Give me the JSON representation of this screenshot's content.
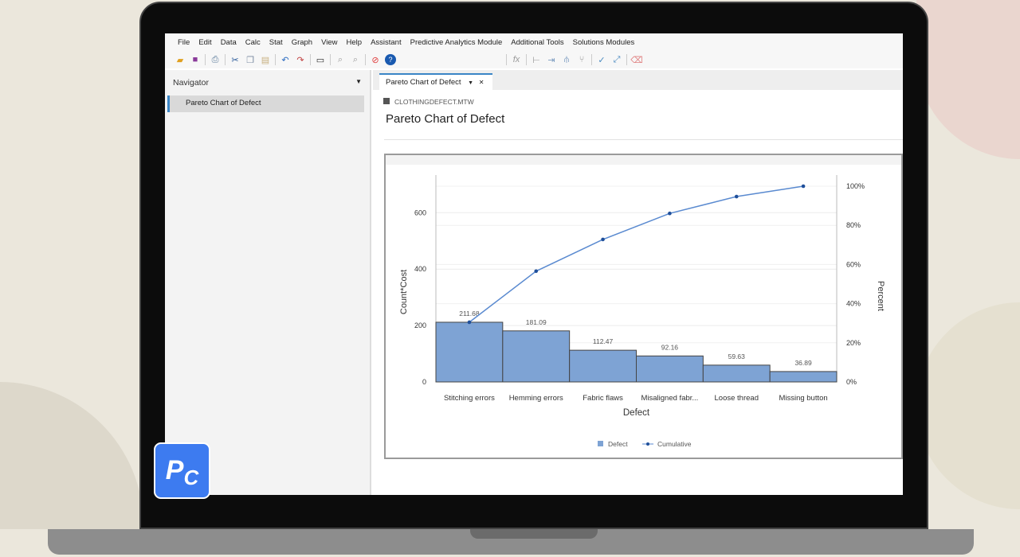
{
  "menu": [
    "File",
    "Edit",
    "Data",
    "Calc",
    "Stat",
    "Graph",
    "View",
    "Help",
    "Assistant",
    "Predictive Analytics Module",
    "Additional Tools",
    "Solutions Modules"
  ],
  "navigator": {
    "title": "Navigator",
    "items": [
      "Pareto Chart of Defect"
    ]
  },
  "tab": {
    "label": "Pareto Chart of Defect",
    "close": "✕"
  },
  "worksheet": "CLOTHINGDEFECT.MTW",
  "page_title": "Pareto Chart of Defect",
  "logo_text": "PC",
  "colors": {
    "bar": "#7ea3d4",
    "line": "#5a8ad0",
    "accent": "#3a85c6"
  },
  "chart_data": {
    "type": "bar",
    "title": "Pareto Chart of Defect",
    "xlabel": "Defect",
    "ylabel": "Count*Cost",
    "y2label": "Percent",
    "categories": [
      "Stitching errors",
      "Hemming errors",
      "Fabric flaws",
      "Misaligned fabr...",
      "Loose thread",
      "Missing button"
    ],
    "values": [
      211.68,
      181.09,
      112.47,
      92.16,
      59.63,
      36.89
    ],
    "value_labels": [
      "211.68",
      "181.09",
      "112.47",
      "92.16",
      "59.63",
      "36.89"
    ],
    "cumulative_percent": [
      30.5,
      56.6,
      72.8,
      86.1,
      94.7,
      100
    ],
    "ylim": [
      0,
      693.92
    ],
    "yticks": [
      0,
      200,
      400,
      600
    ],
    "y2ticks": [
      "0%",
      "20%",
      "40%",
      "60%",
      "80%",
      "100%"
    ],
    "legend": [
      "Defect",
      "Cumulative"
    ],
    "legend_position": "bottom",
    "grid": true
  }
}
